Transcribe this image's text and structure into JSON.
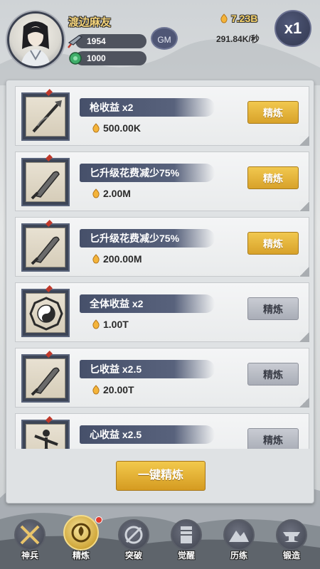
{
  "player": {
    "name": "渡边麻友",
    "stat_weapon": "1954",
    "stat_jade": "1000"
  },
  "header": {
    "gm_label": "GM",
    "gold": "7.23B",
    "rate": "291.84K/秒",
    "speed": "x1"
  },
  "items": [
    {
      "title": "枪收益 x2",
      "cost": "500.00K",
      "button": "精炼",
      "button_state": "active",
      "icon": "spear-icon"
    },
    {
      "title": "匕升级花费减少75%",
      "cost": "2.00M",
      "button": "精炼",
      "button_state": "active",
      "icon": "dagger-icon"
    },
    {
      "title": "匕升级花费减少75%",
      "cost": "200.00M",
      "button": "精炼",
      "button_state": "active",
      "icon": "dagger-icon"
    },
    {
      "title": "全体收益 x2",
      "cost": "1.00T",
      "button": "精炼",
      "button_state": "disabled",
      "icon": "bagua-icon"
    },
    {
      "title": "匕收益 x2.5",
      "cost": "20.00T",
      "button": "精炼",
      "button_state": "disabled",
      "icon": "dagger-icon"
    },
    {
      "title": "心收益 x2.5",
      "cost": "",
      "button": "精炼",
      "button_state": "disabled",
      "icon": "martial-artist-icon"
    }
  ],
  "one_key_button": "一键精炼",
  "nav": [
    {
      "label": "神兵",
      "icon": "crossed-swords-icon",
      "active": false
    },
    {
      "label": "精炼",
      "icon": "refine-icon",
      "active": true
    },
    {
      "label": "突破",
      "icon": "breakthrough-icon",
      "active": false
    },
    {
      "label": "觉醒",
      "icon": "scroll-icon",
      "active": false
    },
    {
      "label": "历练",
      "icon": "mountain-icon",
      "active": false
    },
    {
      "label": "锻造",
      "icon": "anvil-icon",
      "active": false
    }
  ],
  "colors": {
    "gold_button": "#d8a22a",
    "gray_button": "#a9adb7",
    "title_brush": "#46506a",
    "gold_text": "#f3d06a"
  }
}
